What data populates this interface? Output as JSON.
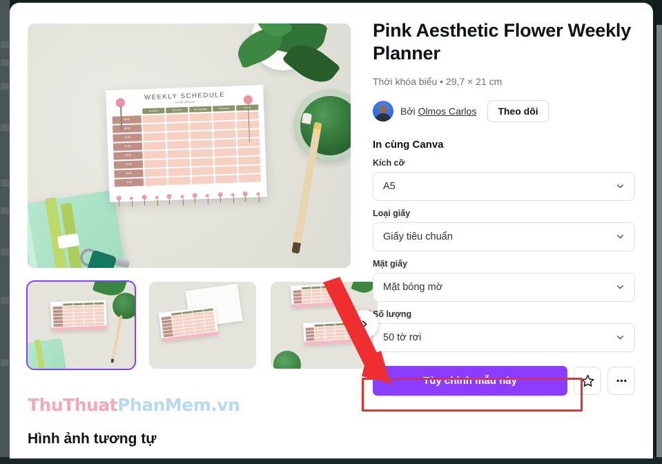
{
  "product": {
    "title": "Pink Aesthetic Flower Weekly Planner",
    "subtitle": "Thời khóa biểu • 29,7 × 21 cm",
    "by_prefix": "Bởi ",
    "author": "Olmos Carlos",
    "follow_label": "Theo dõi",
    "avatar_icon": "user-avatar-photo"
  },
  "print_section": {
    "heading": "In cùng Canva",
    "fields": [
      {
        "label": "Kích cỡ",
        "value": "A5",
        "icon": "chevron-down-icon"
      },
      {
        "label": "Loại giấy",
        "value": "Giấy tiêu chuẩn",
        "icon": "chevron-down-icon"
      },
      {
        "label": "Mặt giấy",
        "value": "Mặt bóng mờ",
        "icon": "chevron-down-icon"
      },
      {
        "label": "Số lượng",
        "value": "50 tờ rơi",
        "icon": "chevron-down-icon"
      }
    ]
  },
  "actions": {
    "primary_label": "Tùy chỉnh mẫu này",
    "favorite_icon": "star-icon",
    "more_icon": "ellipsis-icon"
  },
  "gallery": {
    "next_icon": "chevron-right-icon",
    "selected_index": 0,
    "thumbnails": [
      {
        "alt": "Planner on desk with notebook and pencil"
      },
      {
        "alt": "Planner with blank card on desk"
      },
      {
        "alt": "Two planners on desk with glass"
      }
    ]
  },
  "hero": {
    "alt": "Weekly schedule planner mockup on a desk",
    "planner": {
      "title": "WEEKLY SCHEDULE",
      "subtitle": "· weekly planner ·",
      "days": [
        "Monday",
        "Tuesday",
        "Wednesday",
        "Thursday",
        "Friday"
      ],
      "times": [
        "08:00",
        "09:00",
        "10:00",
        "11:00",
        "12:00",
        "13:00",
        "14:00",
        "15:00"
      ]
    }
  },
  "watermark": {
    "part1": "ThuThuat",
    "part2": "PhanMem.vn"
  },
  "similar": {
    "heading": "Hình ảnh tương tự"
  },
  "colors": {
    "brand_purple": "#8b3dff",
    "annotation_red": "#ef2b2b",
    "selected_border": "#8b3dff",
    "watermark_pink": "#f3aab6",
    "watermark_blue": "#b6dbf0"
  }
}
